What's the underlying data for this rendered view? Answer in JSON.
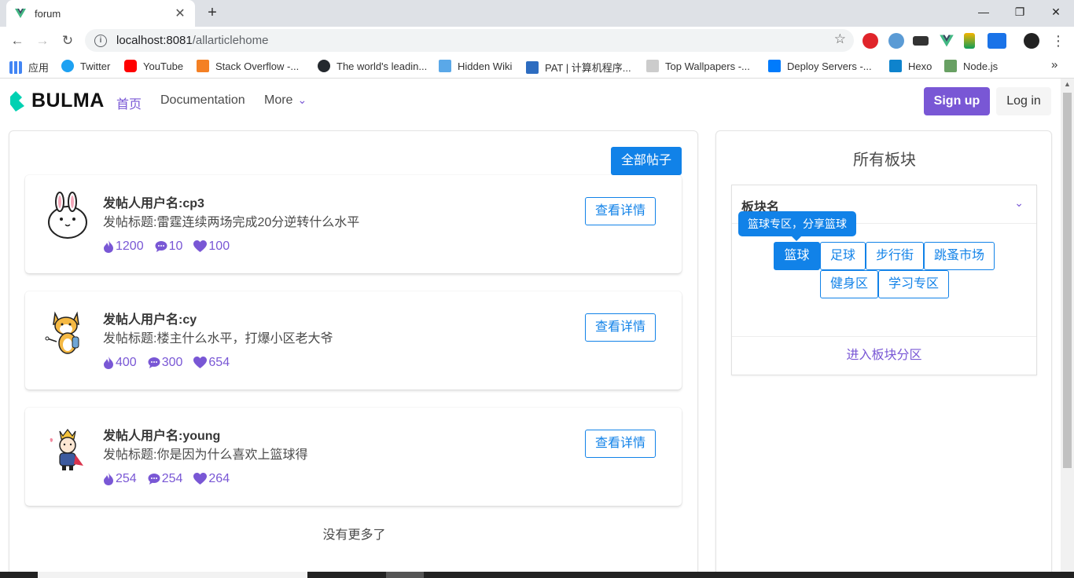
{
  "browser": {
    "tab_title": "forum",
    "tab_close": "✕",
    "new_tab": "+",
    "url_host": "localhost:8081",
    "url_path": "/allarticlehome",
    "bookmarks": [
      {
        "label": "应用",
        "color": "#4285f4"
      },
      {
        "label": "Twitter",
        "color": "#1da1f2"
      },
      {
        "label": "YouTube",
        "color": "#ff0000"
      },
      {
        "label": "Stack Overflow -...",
        "color": "#f48024"
      },
      {
        "label": "The world's leadin...",
        "color": "#24292e"
      },
      {
        "label": "Hidden Wiki",
        "color": "#5aa8e8"
      },
      {
        "label": "PAT | 计算机程序...",
        "color": "#2d6cc0"
      },
      {
        "label": "Top Wallpapers -...",
        "color": "#888888"
      },
      {
        "label": "Deploy Servers -...",
        "color": "#007bfc"
      },
      {
        "label": "Hexo",
        "color": "#0e83cd"
      },
      {
        "label": "Node.js",
        "color": "#68a063"
      }
    ],
    "more_bookmarks": "»"
  },
  "navbar": {
    "brand": "BULMA",
    "links": [
      {
        "label": "首页",
        "active": true
      },
      {
        "label": "Documentation"
      },
      {
        "label": "More"
      }
    ],
    "signup": "Sign up",
    "login": "Log in"
  },
  "posts_panel": {
    "all_posts_button": "全部帖子",
    "posts": [
      {
        "username": "发帖人用户名:cp3",
        "title": "发帖标题:雷霆连续两场完成20分逆转什么水平",
        "views": "1200",
        "comments": "10",
        "likes": "100",
        "detail": "查看详情",
        "avatar": "rabbit"
      },
      {
        "username": "发帖人用户名:cy",
        "title": "发帖标题:楼主什么水平，打爆小区老大爷",
        "views": "400",
        "comments": "300",
        "likes": "654",
        "detail": "查看详情",
        "avatar": "fox"
      },
      {
        "username": "发帖人用户名:young",
        "title": "发帖标题:你是因为什么喜欢上篮球得",
        "views": "254",
        "comments": "254",
        "likes": "264",
        "detail": "查看详情",
        "avatar": "prince"
      }
    ],
    "no_more": "没有更多了"
  },
  "boards_panel": {
    "title": "所有板块",
    "header": "板块名",
    "tooltip": "篮球专区，分享篮球",
    "tags": [
      "篮球",
      "足球",
      "步行街",
      "跳蚤市场",
      "健身区",
      "学习专区"
    ],
    "active_tag": "篮球",
    "enter_link": "进入板块分区"
  },
  "colors": {
    "primary": "#7957d5",
    "info": "#1182e8"
  }
}
